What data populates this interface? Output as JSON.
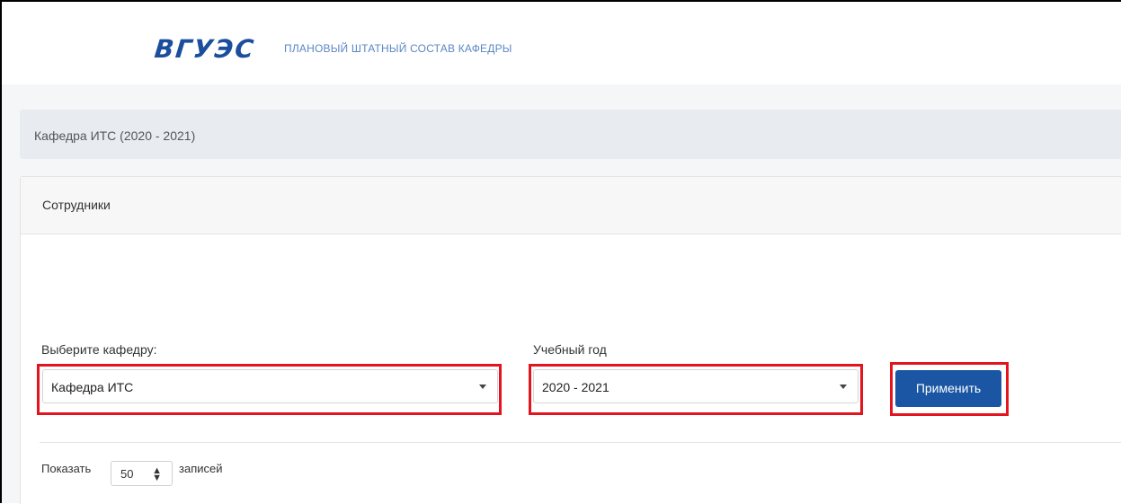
{
  "header": {
    "logo_text": "ВГУЭС",
    "title": "ПЛАНОВЫЙ ШТАТНЫЙ СОСТАВ КАФЕДРЫ"
  },
  "breadcrumb": {
    "text": "Кафедра ИТС (2020 - 2021)"
  },
  "card": {
    "title": "Сотрудники"
  },
  "filters": {
    "department_label": "Выберите кафедру:",
    "department_value": "Кафедра ИТС",
    "year_label": "Учебный год",
    "year_value": "2020 - 2021",
    "apply_label": "Применить"
  },
  "table_length": {
    "prefix": "Показать",
    "value": "50",
    "suffix": "записей"
  },
  "colors": {
    "brand": "#1b4e9c",
    "button": "#1a56a3",
    "highlight": "#e3141e"
  }
}
